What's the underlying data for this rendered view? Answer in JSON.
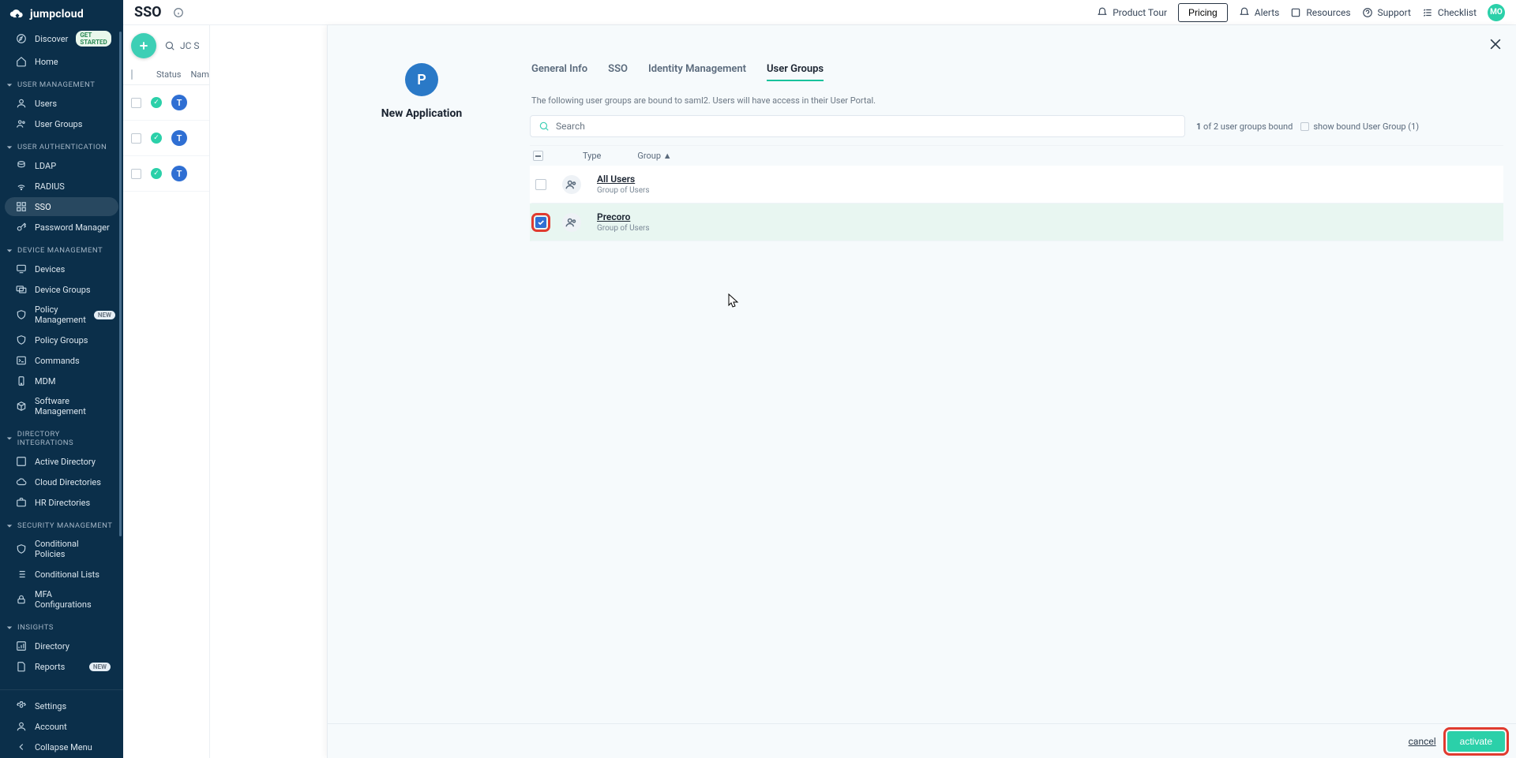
{
  "brand": "jumpcloud",
  "page_title": "SSO",
  "topbar": {
    "product_tour": "Product Tour",
    "pricing": "Pricing",
    "alerts": "Alerts",
    "resources": "Resources",
    "support": "Support",
    "checklist": "Checklist",
    "avatar": "MO"
  },
  "sidebar": {
    "discover": {
      "label": "Discover",
      "badge": "GET STARTED"
    },
    "home": {
      "label": "Home"
    },
    "sections": {
      "user_management": {
        "title": "USER MANAGEMENT",
        "items": [
          {
            "label": "Users"
          },
          {
            "label": "User Groups"
          }
        ]
      },
      "user_authentication": {
        "title": "USER AUTHENTICATION",
        "items": [
          {
            "label": "LDAP"
          },
          {
            "label": "RADIUS"
          },
          {
            "label": "SSO"
          },
          {
            "label": "Password Manager"
          }
        ]
      },
      "device_management": {
        "title": "DEVICE MANAGEMENT",
        "items": [
          {
            "label": "Devices"
          },
          {
            "label": "Device Groups"
          },
          {
            "label": "Policy Management",
            "badge": "NEW"
          },
          {
            "label": "Policy Groups"
          },
          {
            "label": "Commands"
          },
          {
            "label": "MDM"
          },
          {
            "label": "Software Management"
          }
        ]
      },
      "directory_integrations": {
        "title": "DIRECTORY INTEGRATIONS",
        "items": [
          {
            "label": "Active Directory"
          },
          {
            "label": "Cloud Directories"
          },
          {
            "label": "HR Directories"
          }
        ]
      },
      "security_management": {
        "title": "SECURITY MANAGEMENT",
        "items": [
          {
            "label": "Conditional Policies"
          },
          {
            "label": "Conditional Lists"
          },
          {
            "label": "MFA Configurations"
          }
        ]
      },
      "insights": {
        "title": "INSIGHTS",
        "items": [
          {
            "label": "Directory"
          },
          {
            "label": "Reports",
            "badge": "NEW"
          }
        ]
      }
    },
    "bottom": {
      "settings": "Settings",
      "account": "Account",
      "collapse": "Collapse Menu"
    }
  },
  "list": {
    "search": "JC S",
    "head": {
      "status": "Status",
      "name": "Nam"
    },
    "rows": [
      {
        "chip": "T"
      },
      {
        "chip": "T"
      },
      {
        "chip": "T"
      }
    ]
  },
  "panel": {
    "app_initial": "P",
    "app_title": "New Application",
    "tabs": {
      "general": "General Info",
      "sso": "SSO",
      "identity": "Identity Management",
      "user_groups": "User Groups"
    },
    "subtext": "The following user groups are bound to saml2. Users will have access in their User Portal.",
    "search_placeholder": "Search",
    "bound_text_prefix": "1",
    "bound_text_middle": " of 2 ",
    "bound_text_suffix": "user groups bound",
    "show_bound": "show bound User Group (1)",
    "head": {
      "type": "Type",
      "group": "Group"
    },
    "groups": [
      {
        "name": "All Users",
        "sub": "Group of Users",
        "checked": false
      },
      {
        "name": "Precoro",
        "sub": "Group of Users",
        "checked": true
      }
    ],
    "footer": {
      "cancel": "cancel",
      "activate": "activate"
    }
  }
}
